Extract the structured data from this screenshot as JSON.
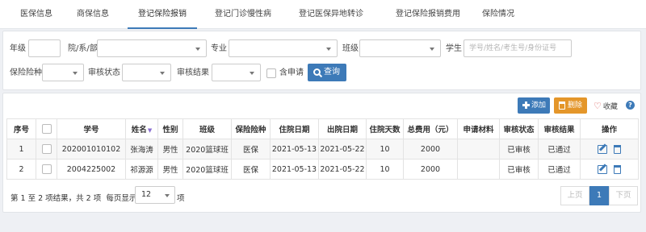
{
  "tabs": [
    "医保信息",
    "商保信息",
    "登记保险报销",
    "登记门诊慢性病",
    "登记医保异地转诊",
    "登记保险报销费用",
    "保险情况"
  ],
  "filters": {
    "grade_label": "年级",
    "dept_label": "院/系/部",
    "major_label": "专业",
    "class_label": "班级",
    "student_label": "学生",
    "student_placeholder": "学号/姓名/考生号/身份证号",
    "insurance_label": "保险险种",
    "review_status_label": "审核状态",
    "review_result_label": "审核结果",
    "include_application_label": "含申请",
    "query_label": "查询"
  },
  "toolbar": {
    "add_label": "添加",
    "delete_label": "删除",
    "favorite_label": "收藏",
    "help_label": "?"
  },
  "table": {
    "headers": [
      "序号",
      "",
      "学号",
      "姓名",
      "性别",
      "班级",
      "保险险种",
      "住院日期",
      "出院日期",
      "住院天数",
      "总费用（元）",
      "申请材料",
      "审核状态",
      "审核结果",
      "操作"
    ],
    "rows": [
      [
        "1",
        "",
        "202001010102",
        "张海涛",
        "男性",
        "2020篮球班",
        "医保",
        "2021-05-13",
        "2021-05-22",
        "10",
        "2000",
        "",
        "已审核",
        "已通过",
        ""
      ],
      [
        "2",
        "",
        "2004225002",
        "祁源源",
        "男性",
        "2020篮球班",
        "医保",
        "2021-05-13",
        "2021-05-22",
        "10",
        "2000",
        "",
        "已审核",
        "已通过",
        ""
      ]
    ]
  },
  "pagination": {
    "info": "第 1 至 2 项结果，共 2 项",
    "per_page_label": "每页显示",
    "page_size": "12",
    "unit": "项",
    "prev": "上页",
    "current": "1",
    "next": "下页"
  },
  "colors": {
    "primary": "#3d7ab8",
    "warning": "#e4962a",
    "heart": "#d9534f"
  }
}
